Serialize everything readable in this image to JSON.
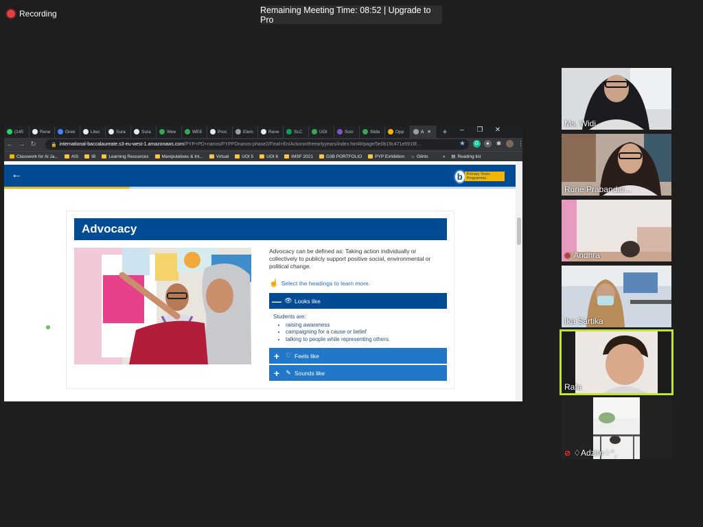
{
  "zoom": {
    "recording_label": "Recording",
    "timer_text": "Remaining Meeting Time: 08:52 | Upgrade to Pro"
  },
  "browser": {
    "tabs": [
      {
        "label": "(145",
        "color": "#25d366"
      },
      {
        "label": "Rene",
        "color": "#e8eaed"
      },
      {
        "label": "Gree",
        "color": "#4285f4"
      },
      {
        "label": "Litec",
        "color": "#e8eaed"
      },
      {
        "label": "Sura",
        "color": "#e8eaed"
      },
      {
        "label": "Sura",
        "color": "#e8eaed"
      },
      {
        "label": "Wee",
        "color": "#34a853"
      },
      {
        "label": "WEE",
        "color": "#34a853"
      },
      {
        "label": "Pros",
        "color": "#e8eaed"
      },
      {
        "label": "Elem",
        "color": "#9aa0a6"
      },
      {
        "label": "Rene",
        "color": "#e8eaed"
      },
      {
        "label": "SLC",
        "color": "#0f9d58"
      },
      {
        "label": "UOI",
        "color": "#34a853"
      },
      {
        "label": "Soci",
        "color": "#7e57c2"
      },
      {
        "label": "Slide",
        "color": "#34a853"
      },
      {
        "label": "Opp",
        "color": "#f4b400"
      },
      {
        "label": "A",
        "color": "#9aa0a6"
      }
    ],
    "new_tab_label": "+",
    "window_controls": {
      "minimize": "–",
      "maximize": "❐",
      "close": "✕"
    },
    "url_host": "international-baccalaureate.s3-eu-west-1.amazonaws.com",
    "url_path": "/PYP+PD+nanos/PYPPDnanos-phase2/Final+En/Actionintheearlyyears/index.html#/page/5e0b19c471e5916f...",
    "bookmarks": [
      {
        "label": "Classwork for Al Ja..."
      },
      {
        "label": "AIS"
      },
      {
        "label": "IB"
      },
      {
        "label": "Learning Resources"
      },
      {
        "label": "Manipulatives & Int..."
      },
      {
        "label": "Virtual"
      },
      {
        "label": "UOI 5"
      },
      {
        "label": "UOI 6"
      },
      {
        "label": "IMSF 2021"
      },
      {
        "label": "G3B PORTFOLIO"
      },
      {
        "label": "PYP Exhibition"
      },
      {
        "label": "Glints"
      }
    ],
    "bookmarks_overflow": "»",
    "reading_list": "Reading list"
  },
  "page": {
    "logo_letter": "b",
    "logo_banner": "Primary Years Programme",
    "progress": 0.245,
    "card_title": "Advocacy",
    "definition": "Advocacy can be defined as: Taking action individually or collectively to publicly support positive social, environmental or political change.",
    "select_hint": "Select the headings to learn more.",
    "accordion": [
      {
        "label": "Looks like",
        "sign": "—",
        "icon": "👁"
      },
      {
        "label": "Feels like",
        "sign": "+",
        "icon": "♡"
      },
      {
        "label": "Sounds like",
        "sign": "+",
        "icon": "✎"
      }
    ],
    "looks_like_intro": "Students are:",
    "looks_like_items": [
      "raising awareness",
      "campaigning for a cause or belief",
      "talking to people while representing others."
    ]
  },
  "participants": [
    {
      "name": "Ms. Widi",
      "muted": false
    },
    {
      "name": "Rurie Prabandar...",
      "muted": false
    },
    {
      "name": "Andhra",
      "muted": true
    },
    {
      "name": "Ika Sartika",
      "muted": false
    },
    {
      "name": "Rafa",
      "muted": false,
      "active_speaker": true
    },
    {
      "name": "♢Adzim♢°¸",
      "muted": true
    }
  ]
}
